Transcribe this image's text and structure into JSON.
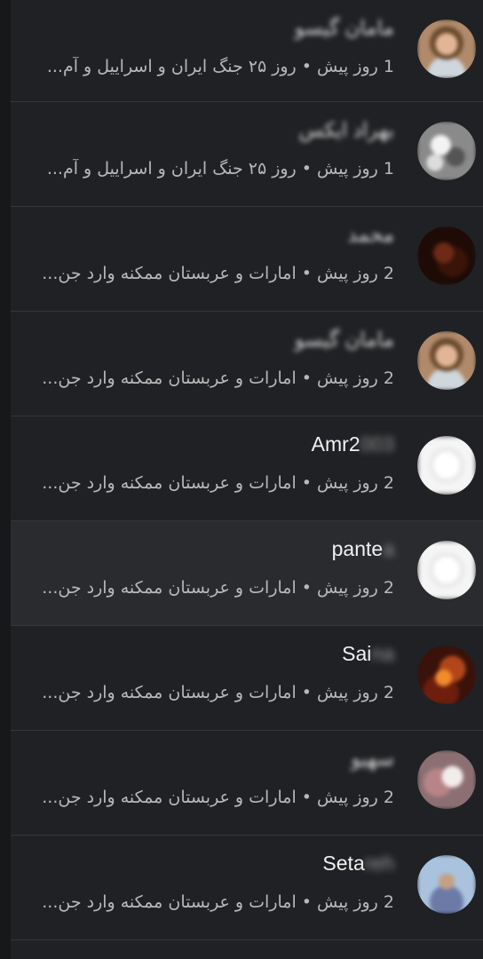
{
  "conversations": [
    {
      "name": "مامان گیسو",
      "name_blurred": true,
      "time": "1 روز پیش",
      "separator": "•",
      "preview": "روز ۲۵ جنگ ایران و اسراییل و آم...",
      "avatar": "portrait-woman-avatar",
      "selected": false
    },
    {
      "name": "بهراد ایکس",
      "name_blurred": true,
      "time": "1 روز پیش",
      "separator": "•",
      "preview": "روز ۲۵ جنگ ایران و اسراییل و آم...",
      "avatar": "gray-photo-avatar",
      "selected": false
    },
    {
      "name": "محمد",
      "name_blurred": true,
      "time": "2 روز پیش",
      "separator": "•",
      "preview": "امارات و عربستان ممکنه وارد جن...",
      "avatar": "dark-photo-avatar",
      "selected": false
    },
    {
      "name": "مامان گیسو",
      "name_blurred": true,
      "time": "2 روز پیش",
      "separator": "•",
      "preview": "امارات و عربستان ممکنه وارد جن...",
      "avatar": "portrait-woman-avatar",
      "selected": false
    },
    {
      "name_visible": "Amr2",
      "name_hidden": "003",
      "time": "2 روز پیش",
      "separator": "•",
      "preview": "امارات و عربستان ممکنه وارد جن...",
      "avatar": "white-blur-avatar",
      "selected": false
    },
    {
      "name_visible": "pante",
      "name_hidden": "a",
      "time": "2 روز پیش",
      "separator": "•",
      "preview": "امارات و عربستان ممکنه وارد جن...",
      "avatar": "white-blur-avatar",
      "selected": true
    },
    {
      "name_visible": "Sai",
      "name_hidden": "na",
      "time": "2 روز پیش",
      "separator": "•",
      "preview": "امارات و عربستان ممکنه وارد جن...",
      "avatar": "fire-photo-avatar",
      "selected": false
    },
    {
      "name": "سهیو",
      "name_blurred": true,
      "time": "2 روز پیش",
      "separator": "•",
      "preview": "امارات و عربستان ممکنه وارد جن...",
      "avatar": "pink-photo-avatar",
      "selected": false
    },
    {
      "name_visible": "Seta",
      "name_hidden": "reh",
      "time": "2 روز پیش",
      "separator": "•",
      "preview": "امارات و عربستان ممکنه وارد جن...",
      "avatar": "sky-photo-avatar",
      "selected": false
    }
  ]
}
